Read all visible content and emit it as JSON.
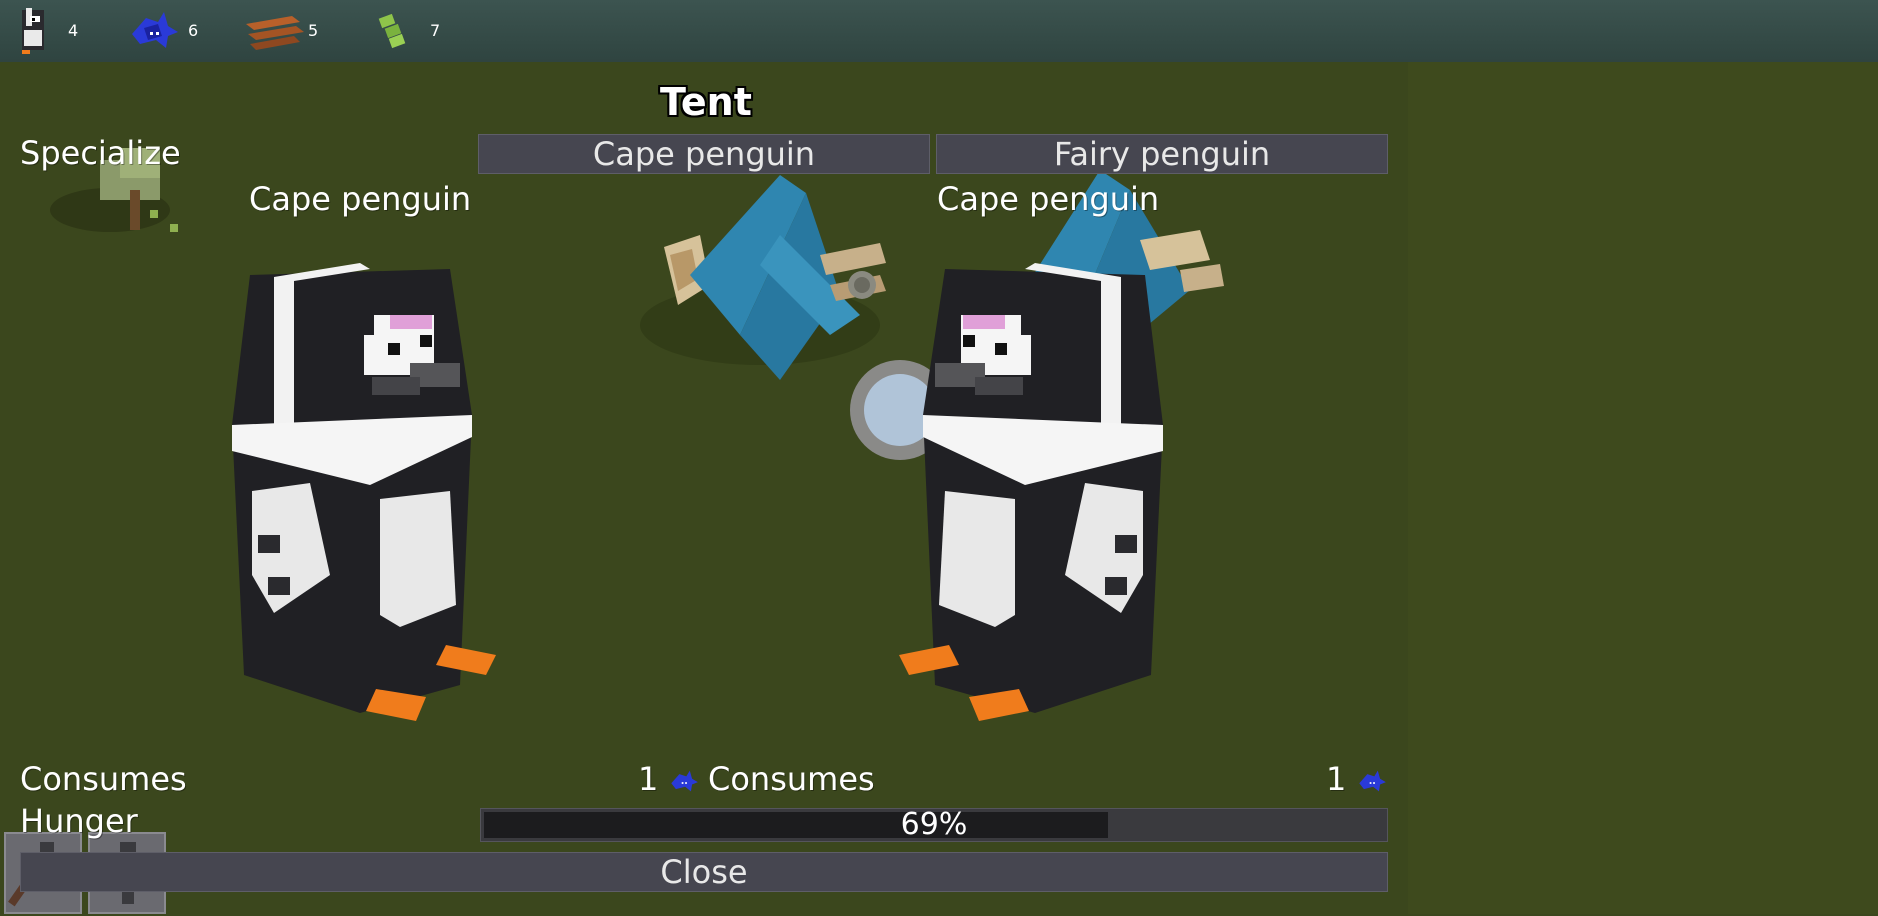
{
  "resources": [
    {
      "icon": "penguin-icon",
      "count": "4"
    },
    {
      "icon": "fish-icon",
      "count": "6"
    },
    {
      "icon": "wood-logs-icon",
      "count": "5"
    },
    {
      "icon": "bamboo-icon",
      "count": "7"
    }
  ],
  "dialog": {
    "title": "Tent",
    "specialize_label": "Specialize",
    "option_buttons": [
      "Cape penguin",
      "Fairy penguin"
    ],
    "left": {
      "name": "Cape penguin",
      "consumes_label": "Consumes",
      "consumes_amount": "1",
      "consumes_icon": "fish-icon"
    },
    "right": {
      "name": "Cape penguin",
      "consumes_label": "Consumes",
      "consumes_amount": "1",
      "consumes_icon": "fish-icon"
    },
    "hunger_label": "Hunger",
    "hunger_percent": "69%",
    "hunger_value": 0.69,
    "close_label": "Close"
  },
  "colors": {
    "top_bar": "#34494a",
    "ground": "#3b471d",
    "button": "#464650",
    "penguin_black": "#1e1e22",
    "penguin_white": "#f0f0f0",
    "penguin_feet": "#f07c1c",
    "eyebrow": "#e0a0d8",
    "tent_blue": "#2f86b0"
  }
}
